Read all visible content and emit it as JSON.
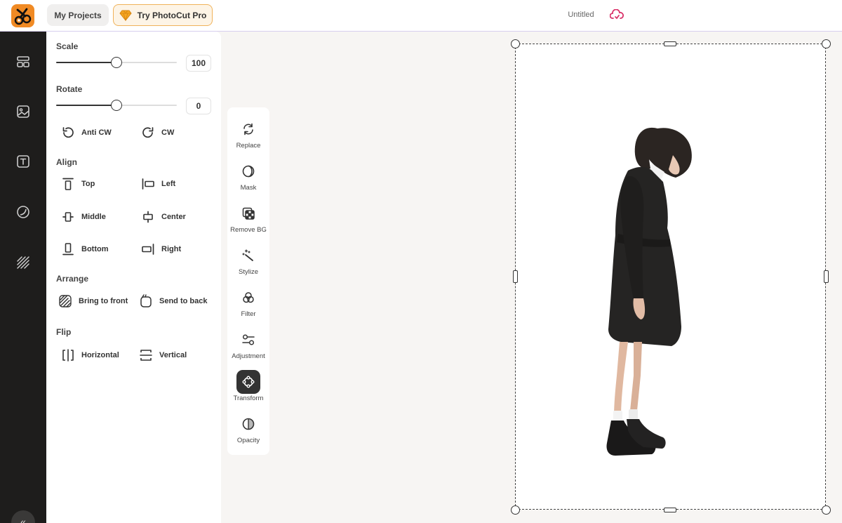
{
  "topbar": {
    "my_projects": "My Projects",
    "try_pro": "Try PhotoCut Pro",
    "doc_title": "Untitled",
    "accent": "#f08a24",
    "cloud_color": "#d9336a"
  },
  "rail": {
    "items": [
      "templates-icon",
      "photos-icon",
      "text-icon",
      "elements-icon",
      "patterns-icon"
    ],
    "collapse": "«"
  },
  "panel": {
    "scale": {
      "label": "Scale",
      "value": "100",
      "level": 0.5
    },
    "rotate": {
      "label": "Rotate",
      "value": "0",
      "level": 0.5
    },
    "rotate_buttons": {
      "anti_cw": "Anti CW",
      "cw": "CW"
    },
    "align": {
      "title": "Align",
      "top": "Top",
      "left": "Left",
      "middle": "Middle",
      "center": "Center",
      "bottom": "Bottom",
      "right": "Right"
    },
    "arrange": {
      "title": "Arrange",
      "bring_front": "Bring to front",
      "send_back": "Send to back"
    },
    "flip": {
      "title": "Flip",
      "horizontal": "Horizontal",
      "vertical": "Vertical"
    }
  },
  "toolbar": {
    "items": [
      {
        "label": "Replace",
        "icon": "replace-icon"
      },
      {
        "label": "Mask",
        "icon": "mask-icon"
      },
      {
        "label": "Remove BG",
        "icon": "remove-bg-icon"
      },
      {
        "label": "Stylize",
        "icon": "stylize-icon"
      },
      {
        "label": "Filter",
        "icon": "filter-icon"
      },
      {
        "label": "Adjustment",
        "icon": "adjustment-icon"
      },
      {
        "label": "Transform",
        "icon": "transform-icon",
        "active": true
      },
      {
        "label": "Opacity",
        "icon": "opacity-icon"
      }
    ]
  }
}
